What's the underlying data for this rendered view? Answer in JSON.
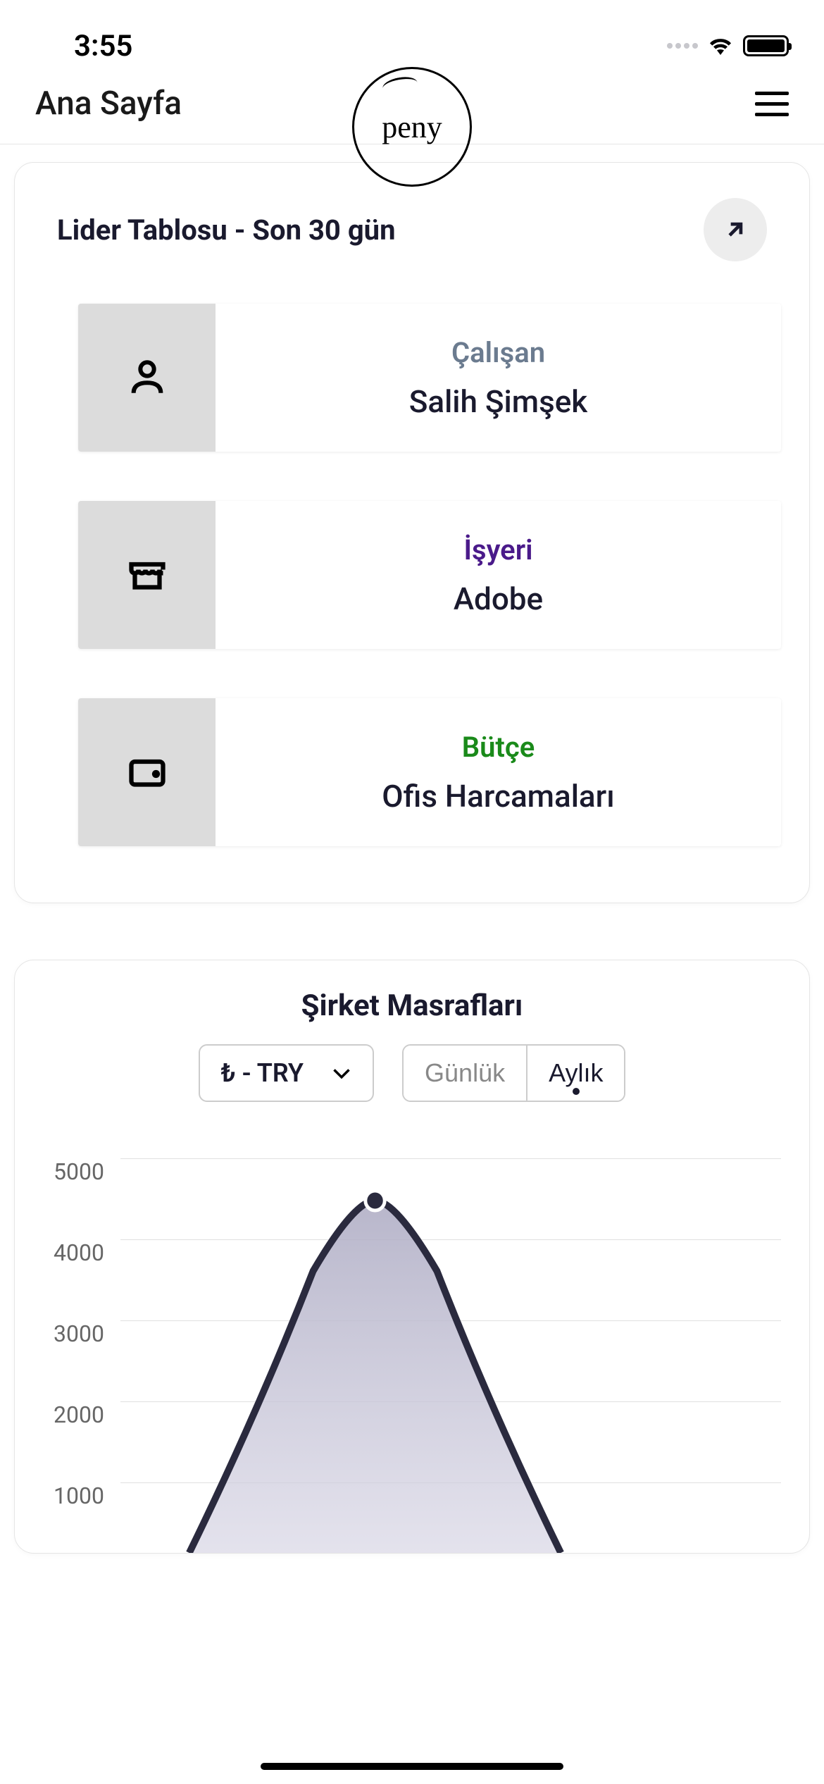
{
  "status_bar": {
    "time": "3:55"
  },
  "header": {
    "title": "Ana Sayfa",
    "logo_text": "peny"
  },
  "leaderboard": {
    "title": "Lider Tablosu - Son 30 gün",
    "items": [
      {
        "label": "Çalışan",
        "value": "Salih Şimşek",
        "icon": "person-icon",
        "color_class": "employee"
      },
      {
        "label": "İşyeri",
        "value": "Adobe",
        "icon": "store-icon",
        "color_class": "workplace"
      },
      {
        "label": "Bütçe",
        "value": "Ofis Harcamaları",
        "icon": "wallet-icon",
        "color_class": "budget"
      }
    ]
  },
  "expenses": {
    "title": "Şirket Masrafları",
    "currency_label": "₺ - TRY",
    "toggle": {
      "daily": "Günlük",
      "monthly": "Aylık",
      "active": "monthly"
    }
  },
  "chart_data": {
    "type": "area",
    "title": "Şirket Masrafları",
    "ylabel": "",
    "xlabel": "",
    "ylim": [
      0,
      5000
    ],
    "y_ticks": [
      1000,
      2000,
      3000,
      4000,
      5000
    ],
    "peak_value": 4500,
    "series": [
      {
        "name": "expenses",
        "values": [
          0,
          500,
          1800,
          3500,
          4400,
          4500,
          4400,
          3500,
          1800,
          500,
          0
        ]
      }
    ]
  }
}
